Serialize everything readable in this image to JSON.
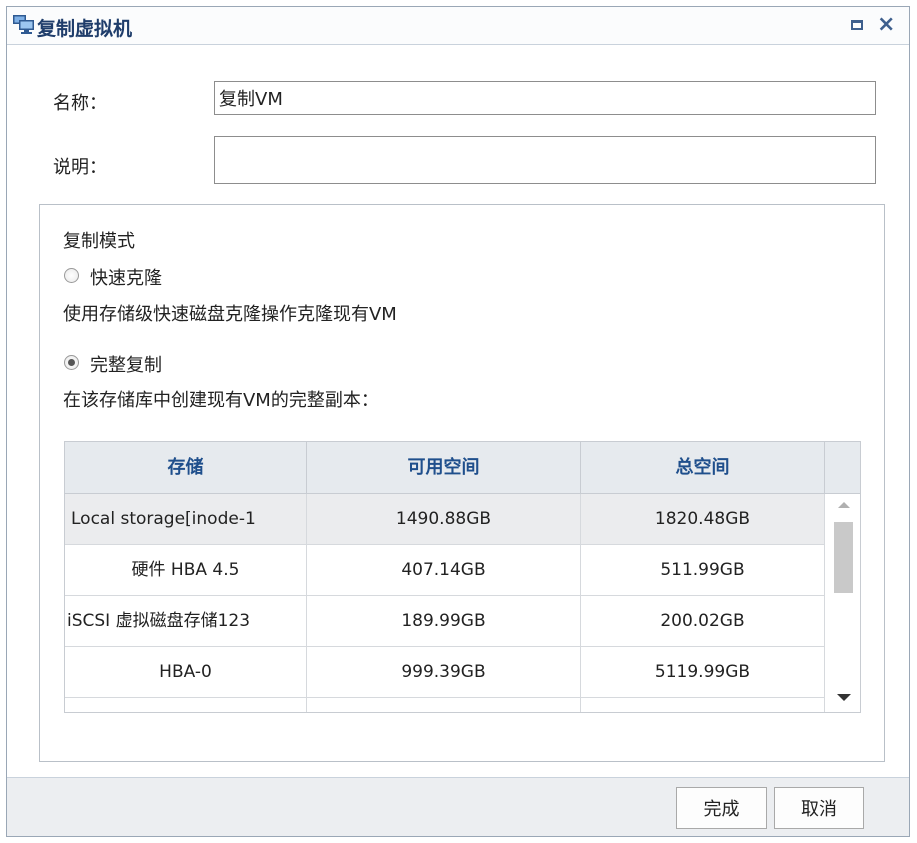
{
  "dialog": {
    "title": "复制虚拟机"
  },
  "form": {
    "name_label": "名称：",
    "name_value": "复制VM",
    "desc_label": "说明：",
    "desc_value": ""
  },
  "copy_mode": {
    "heading": "复制模式",
    "options": [
      {
        "label": "快速克隆",
        "description": "使用存储级快速磁盘克隆操作克隆现有VM",
        "checked": false
      },
      {
        "label": "完整复制",
        "description": "在该存储库中创建现有VM的完整副本：",
        "checked": true
      }
    ]
  },
  "storage_table": {
    "columns": [
      "存储",
      "可用空间",
      "总空间"
    ],
    "rows": [
      {
        "name": "Local storage[inode-1",
        "available": "1490.88GB",
        "total": "1820.48GB"
      },
      {
        "name": "硬件 HBA 4.5",
        "available": "407.14GB",
        "total": "511.99GB"
      },
      {
        "name": "iSCSI 虚拟磁盘存储123",
        "available": "189.99GB",
        "total": "200.02GB"
      },
      {
        "name": "HBA-0",
        "available": "999.39GB",
        "total": "5119.99GB"
      },
      {
        "name": "",
        "available": "",
        "total": ""
      }
    ]
  },
  "buttons": {
    "finish": "完成",
    "cancel": "取消"
  },
  "colors": {
    "accent": "#1f4f8c",
    "title": "#1f3d6b",
    "footer_bg": "#eceef1"
  }
}
